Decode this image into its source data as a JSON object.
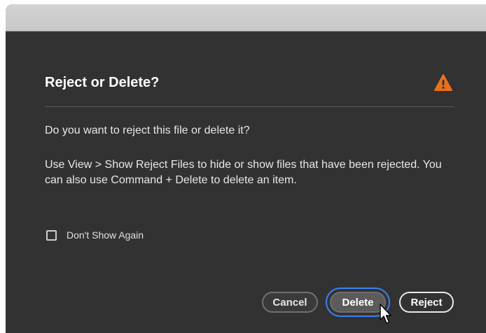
{
  "dialog": {
    "title": "Reject or Delete?",
    "question": "Do you want to reject this file or delete it?",
    "description": "Use View > Show Reject Files to hide or show files that have been rejected. You can also use Command + Delete to delete an item.",
    "checkbox_label": "Don't Show Again",
    "checkbox_checked": false,
    "warning_icon": "warning-triangle-icon",
    "warning_color": "#e8711a"
  },
  "buttons": {
    "cancel_label": "Cancel",
    "delete_label": "Delete",
    "reject_label": "Reject"
  },
  "colors": {
    "dialog_bg": "#323232",
    "focus_ring": "#3b82f6",
    "titlebar": "#d0d0d0"
  }
}
